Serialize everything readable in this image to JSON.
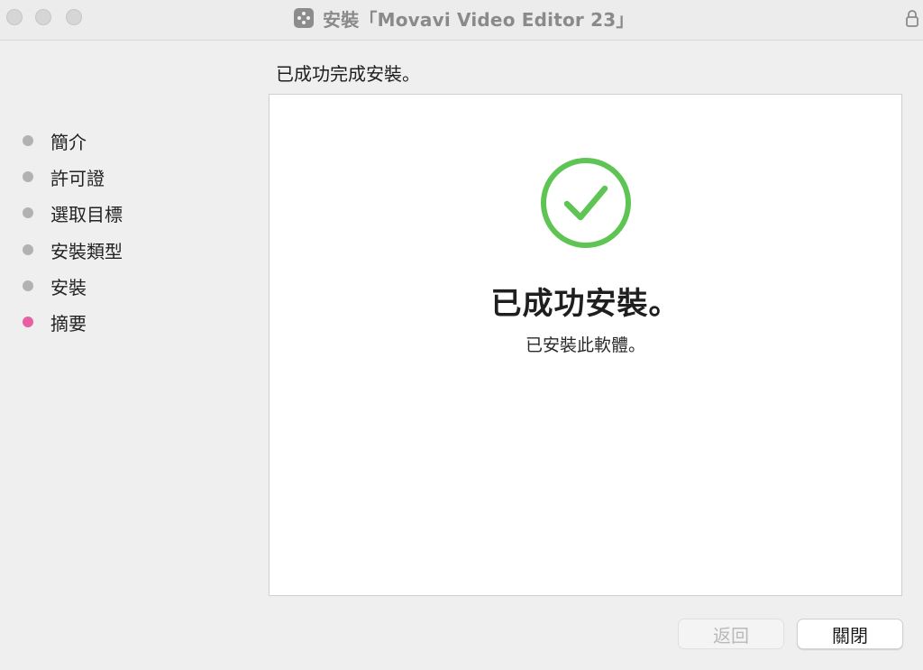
{
  "window": {
    "title": "安裝「Movavi Video Editor 23」"
  },
  "sidebar": {
    "items": [
      {
        "label": "簡介",
        "state": "done"
      },
      {
        "label": "許可證",
        "state": "done"
      },
      {
        "label": "選取目標",
        "state": "done"
      },
      {
        "label": "安裝類型",
        "state": "done"
      },
      {
        "label": "安裝",
        "state": "done"
      },
      {
        "label": "摘要",
        "state": "current"
      }
    ]
  },
  "main": {
    "heading": "已成功完成安裝。",
    "result_title": "已成功安裝。",
    "result_subtitle": "已安裝此軟體。"
  },
  "buttons": {
    "back_label": "返回",
    "close_label": "關閉"
  },
  "icons": {
    "app": "movavi-app-icon",
    "lock": "lock-icon",
    "success": "checkmark-circle-icon"
  },
  "colors": {
    "success_green": "#5ec453",
    "active_step": "#e85fa4",
    "inactive_step": "#b2b2b2"
  }
}
